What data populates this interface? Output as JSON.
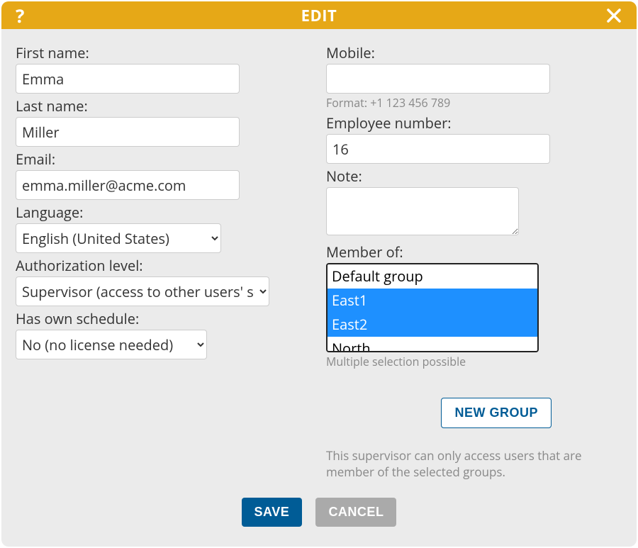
{
  "header": {
    "title": "EDIT"
  },
  "left": {
    "first_name": {
      "label": "First name:",
      "value": "Emma"
    },
    "last_name": {
      "label": "Last name:",
      "value": "Miller"
    },
    "email": {
      "label": "Email:",
      "value": "emma.miller@acme.com"
    },
    "language": {
      "label": "Language:",
      "value": "English (United States)"
    },
    "authorization": {
      "label": "Authorization level:",
      "value": "Supervisor (access to other users' schedules)"
    },
    "has_schedule": {
      "label": "Has own schedule:",
      "value": "No (no license needed)"
    }
  },
  "right": {
    "mobile": {
      "label": "Mobile:",
      "value": "",
      "hint": "Format: +1 123 456 789"
    },
    "emp_no": {
      "label": "Employee number:",
      "value": "16"
    },
    "note": {
      "label": "Note:",
      "value": ""
    },
    "member_of": {
      "label": "Member of:",
      "options": [
        {
          "label": "Default group",
          "selected": false
        },
        {
          "label": "East1",
          "selected": true
        },
        {
          "label": "East2",
          "selected": true
        },
        {
          "label": "North",
          "selected": false
        }
      ],
      "hint": "Multiple selection possible"
    },
    "new_group_label": "NEW GROUP",
    "info": "This supervisor can only access users that are member of the selected groups."
  },
  "footer": {
    "save": "SAVE",
    "cancel": "CANCEL"
  }
}
